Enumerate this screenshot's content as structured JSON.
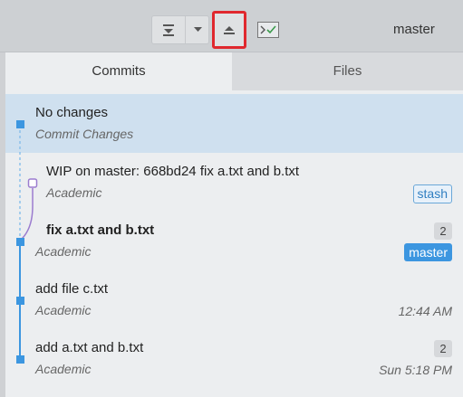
{
  "toolbar": {
    "pull_icon": "pull-icon",
    "dropdown_icon": "chevron-down-icon",
    "push_icon": "push-icon",
    "terminal_icon": "terminal-icon",
    "branch": "master"
  },
  "tabs": [
    {
      "label": "Commits",
      "active": true
    },
    {
      "label": "Files",
      "active": false
    }
  ],
  "commits": [
    {
      "title": "No changes",
      "subtitle": "Commit Changes",
      "count": "",
      "badge": "",
      "time": ""
    },
    {
      "title": "WIP on master: 668bd24 fix a.txt and b.txt",
      "subtitle": "Academic",
      "count": "",
      "badge": "stash",
      "time": ""
    },
    {
      "title": "fix a.txt and b.txt",
      "subtitle": "Academic",
      "count": "2",
      "badge": "master",
      "time": ""
    },
    {
      "title": "add file c.txt",
      "subtitle": "Academic",
      "count": "",
      "badge": "",
      "time": "12:44 AM"
    },
    {
      "title": "add a.txt and b.txt",
      "subtitle": "Academic",
      "count": "2",
      "badge": "",
      "time": "Sun 5:18 PM"
    }
  ],
  "colors": {
    "accent": "#3c96e0",
    "highlight": "#e0282e",
    "selected_row": "#cfe0ef",
    "stash_node": "#9b7ccf"
  }
}
